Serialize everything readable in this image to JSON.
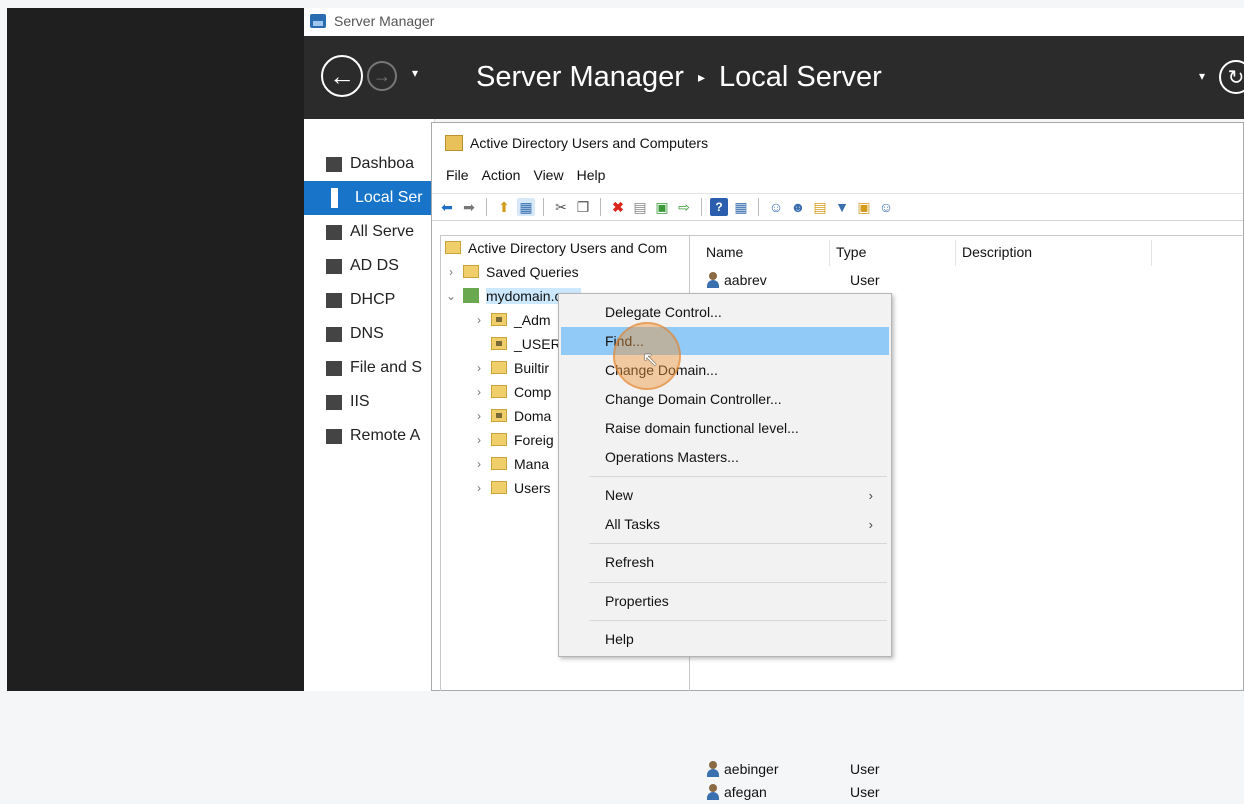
{
  "server_manager": {
    "window_title": "Server Manager",
    "breadcrumb": [
      "Server Manager",
      "Local Server"
    ],
    "breadcrumb_separator": "▸",
    "back_glyph": "←",
    "forward_glyph": "→",
    "dropdown_glyph": "▾",
    "refresh_glyph": "↻",
    "sidebar": [
      {
        "label": "Dashboa",
        "icon": "dashboard-icon",
        "active": false
      },
      {
        "label": "Local Ser",
        "icon": "server-icon",
        "active": true
      },
      {
        "label": "All Serve",
        "icon": "servers-icon",
        "active": false
      },
      {
        "label": "AD DS",
        "icon": "adds-icon",
        "active": false
      },
      {
        "label": "DHCP",
        "icon": "dhcp-icon",
        "active": false
      },
      {
        "label": "DNS",
        "icon": "dns-icon",
        "active": false
      },
      {
        "label": "File and S",
        "icon": "file-services-icon",
        "active": false
      },
      {
        "label": "IIS",
        "icon": "iis-icon",
        "active": false
      },
      {
        "label": "Remote A",
        "icon": "remote-access-icon",
        "active": false
      }
    ]
  },
  "aduc": {
    "title": "Active Directory Users and Computers",
    "menu": [
      "File",
      "Action",
      "View",
      "Help"
    ],
    "tree": {
      "root": "Active Directory Users and Com",
      "saved_queries": "Saved Queries",
      "domain": "mydomain.com",
      "children": [
        "_Adm",
        "_USER",
        "Builtir",
        "Comp",
        "Doma",
        "Foreig",
        "Mana",
        "Users"
      ]
    },
    "list": {
      "columns": [
        "Name",
        "Type",
        "Description"
      ],
      "rows": [
        {
          "name": "aabrev",
          "type": "User"
        },
        {
          "name": "aebinger",
          "type": "User"
        },
        {
          "name": "afegan",
          "type": "User"
        }
      ]
    }
  },
  "context_menu": {
    "items": [
      {
        "label": "Delegate Control..."
      },
      {
        "label": "Find...",
        "highlighted": true
      },
      {
        "label": "Change Domain..."
      },
      {
        "label": "Change Domain Controller..."
      },
      {
        "label": "Raise domain functional level..."
      },
      {
        "label": "Operations Masters..."
      },
      {
        "label": "New",
        "submenu": true
      },
      {
        "label": "All Tasks",
        "submenu": true
      },
      {
        "label": "Refresh"
      },
      {
        "label": "Properties"
      },
      {
        "label": "Help"
      }
    ],
    "submenu_arrow": "›"
  },
  "colors": {
    "accent": "#1874c9",
    "header_bg": "#2b2b2b",
    "menu_highlight": "#91c9f7",
    "click_marker": "#ee963c"
  }
}
